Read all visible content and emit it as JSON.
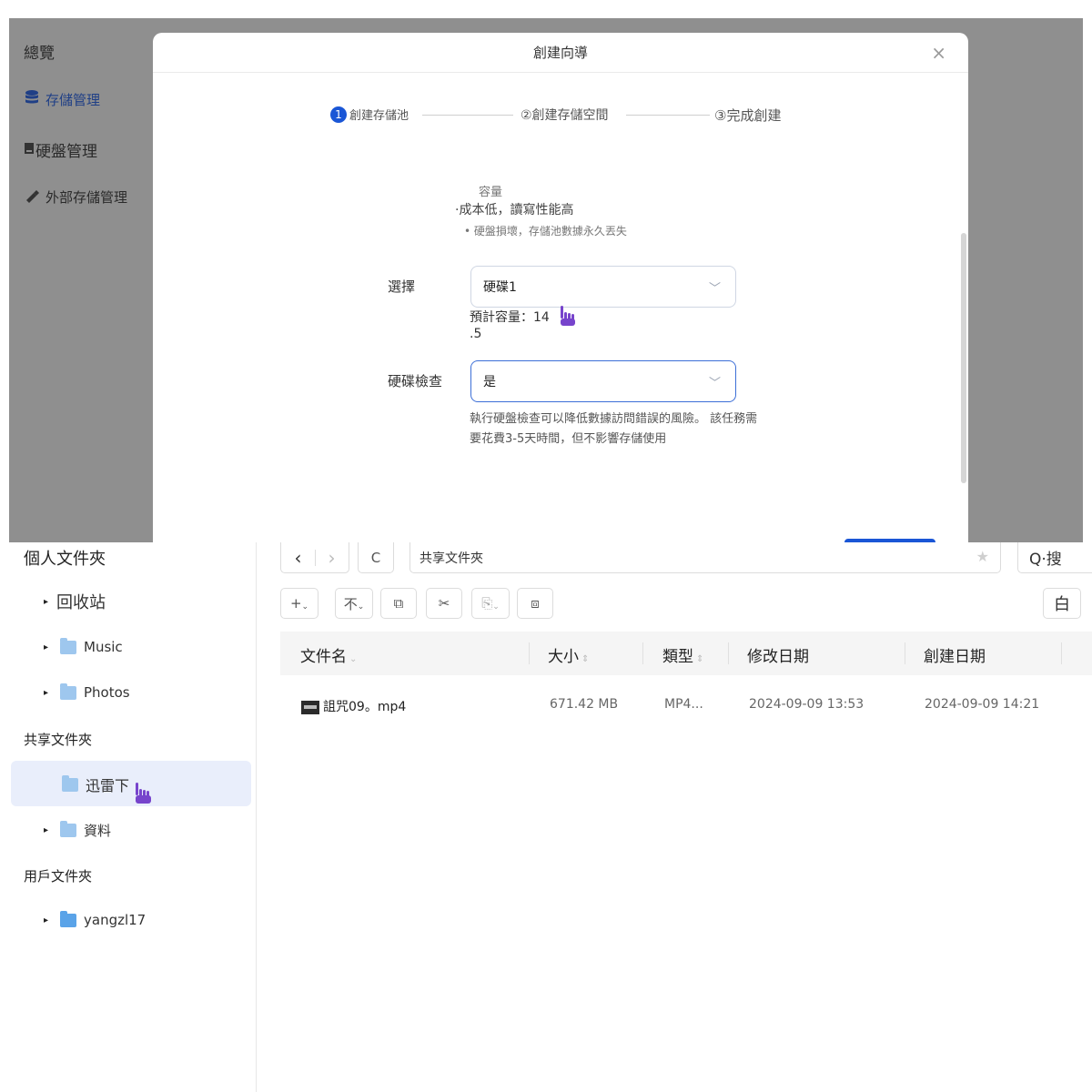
{
  "top_sidebar": {
    "items": [
      {
        "label": "總覽",
        "icon": ""
      },
      {
        "label": "存儲管理",
        "icon": "database-icon"
      },
      {
        "label": "硬盤管理",
        "icon": "disk-icon"
      },
      {
        "label": "外部存儲管理",
        "icon": "usb-icon"
      }
    ]
  },
  "modal": {
    "title": "創建向導",
    "close": "×",
    "steps": [
      {
        "number": "1",
        "label": "創建存儲池"
      },
      {
        "label": "②創建存儲空間"
      },
      {
        "label": "③完成創建"
      }
    ],
    "info": {
      "capacity_label": "容量",
      "feature": "·成本低，讀寫性能高",
      "warning": "• 硬盤損壞，存儲池數據永久丟失"
    },
    "select_field": {
      "label": "選擇",
      "value": "硬碟1",
      "estimate_line1": "預計容量：14",
      "estimate_line2": ".5"
    },
    "check_field": {
      "label": "硬碟檢查",
      "value": "是",
      "hint": "執行硬盤檢查可以降低數據訪問錯誤的風險。 該任務需要花費3-5天時間，但不影響存儲使用"
    }
  },
  "file_manager": {
    "sidebar": {
      "personal_section": "個人文件夾",
      "recycle": "回收站",
      "music": "Music",
      "photos": "Photos",
      "shared_section": "共享文件夾",
      "xunlei": "迅雷下",
      "data": "資料",
      "user_section": "用戶文件夾",
      "user": "yangzl17"
    },
    "toolbar": {
      "back": "‹",
      "forward": "›",
      "refresh": "C",
      "path": "共享文件夾",
      "search": "Q·搜",
      "add": "+",
      "add_caret": "⌄",
      "upload": "不",
      "upload_caret": "⌄",
      "copy": "⧉",
      "cut": "✂",
      "paste": "⎘",
      "paste_caret": "⌄",
      "move": "⧈",
      "view": "白"
    },
    "table": {
      "columns": [
        "文件名",
        "大小",
        "類型",
        "修改日期",
        "創建日期"
      ],
      "rows": [
        {
          "name": "詛咒09。mp4",
          "size": "671.42 MB",
          "type": "MP4...",
          "modified": "2024-09-09 13:53",
          "created": "2024-09-09 14:21"
        }
      ]
    }
  }
}
